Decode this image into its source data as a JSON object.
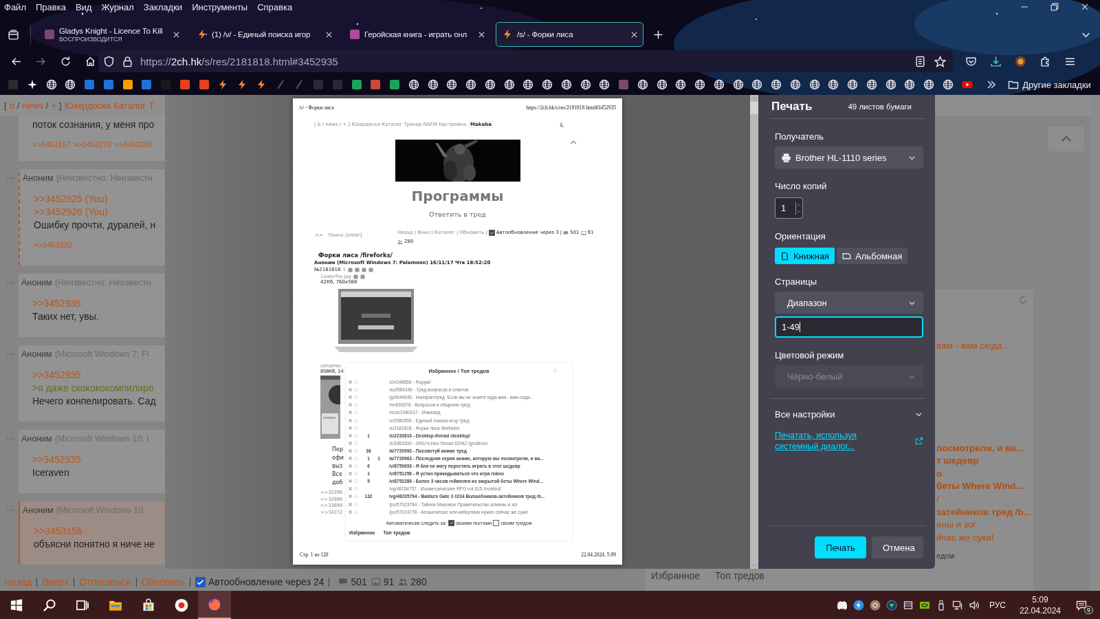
{
  "menu": [
    "Файл",
    "Правка",
    "Вид",
    "Журнал",
    "Закладки",
    "Инструменты",
    "Справка"
  ],
  "tabs": [
    {
      "kind": "letter",
      "title": "Gladys Knight - Licence To Kill",
      "subtitle": "ВОСПРОИЗВОДИТСЯ",
      "selected": false
    },
    {
      "kind": "bolt",
      "title": "(1) /v/ - Единый поиска игор",
      "selected": false
    },
    {
      "kind": "game",
      "title": "Геройская книга - играть онл",
      "selected": false
    },
    {
      "kind": "bolt",
      "title": "/s/ - Форки лиса",
      "selected": true
    }
  ],
  "address": {
    "scheme": "https://",
    "host": "2ch.hk",
    "path": "/s/res/2181818.html#3452935"
  },
  "other_bookmarks": "Другие закладки",
  "page": {
    "nav": [
      {
        "kind": "plain",
        "text": "["
      },
      {
        "kind": "link",
        "text": "b"
      },
      {
        "kind": "plain",
        "text": "/"
      },
      {
        "kind": "link",
        "text": "news"
      },
      {
        "kind": "plain",
        "text": "/"
      },
      {
        "kind": "link",
        "text": "+"
      },
      {
        "kind": "plain",
        "text": "]"
      },
      {
        "kind": "link",
        "text": "Юзердоски"
      },
      {
        "kind": "link",
        "text": "Каталог"
      },
      {
        "kind": "link",
        "text": "Т"
      }
    ],
    "posts": [
      {
        "kind": "normal",
        "lines": [
          {
            "kind": "text",
            "text": "поток сознания, у меня про"
          },
          {
            "kind": "backrefs",
            "refs": [
              ">>3453157",
              ">>3453270",
              ">>3453289"
            ]
          }
        ]
      },
      {
        "kind": "reply",
        "author": "Аноним",
        "meta": "(Неизвестно: Неизвестн",
        "lines": [
          {
            "kind": "ref",
            "text": ">>3452925 (You)"
          },
          {
            "kind": "ref",
            "text": ">>3452926 (You)"
          },
          {
            "kind": "text",
            "text": "Ошибку прочти, дуралей, н"
          },
          {
            "kind": "backrefs",
            "refs": [
              ">>3453330"
            ]
          }
        ]
      },
      {
        "kind": "normal",
        "author": "Аноним",
        "meta": "(Неизвестно: Неизвестн",
        "lines": [
          {
            "kind": "ref",
            "text": ">>3452935"
          },
          {
            "kind": "text",
            "text": "Таких нет, увы."
          }
        ]
      },
      {
        "kind": "normal",
        "author": "Аноним",
        "meta": "(Microsoft Windows 7: Fi",
        "lines": [
          {
            "kind": "ref",
            "text": ">>3452935"
          },
          {
            "kind": "quote",
            "text": ">я даже скокококомпилиро"
          },
          {
            "kind": "text",
            "text": "Нечего конпелировать. Сад"
          }
        ]
      },
      {
        "kind": "normal",
        "author": "Аноним",
        "meta": "(Microsoft Windows 10: I",
        "lines": [
          {
            "kind": "ref",
            "text": ">>3452935"
          },
          {
            "kind": "text",
            "text": "Iceraven"
          }
        ]
      },
      {
        "kind": "highlighted",
        "author": "Аноним",
        "meta": "(Microsoft Windows 10:",
        "lines": [
          {
            "kind": "ref",
            "text": ">>3453156"
          },
          {
            "kind": "text",
            "text": "объясни понятно я ниче не"
          }
        ]
      }
    ],
    "bottom_links": [
      "Назад",
      "Вверх",
      "Отписаться",
      "Обновить"
    ],
    "autoupdate": {
      "label": "Автообновление через 24",
      "checked": true
    },
    "stats": {
      "posts": "501",
      "images": "91",
      "posters": "280"
    },
    "favorites_fragments": [
      {
        "text": "вам - вам сюда...",
        "unread": false
      },
      {
        "text": "посмотрели, и ва...",
        "unread": true
      },
      {
        "text": "т шедевр",
        "unread": true
      },
      {
        "text": "о",
        "unread": true
      },
      {
        "text": "беты Where Wind...",
        "unread": true
      },
      {
        "text": "/",
        "unread": false
      },
      {
        "text": "затейников тред /b...",
        "unread": true
      },
      {
        "text": "ены и зог",
        "unread": false
      },
      {
        "text": "йчас же суки!",
        "unread": false
      }
    ],
    "favorites_watch_fragment": "едом",
    "favorites_tabs": [
      "Избранное",
      "Топ тредов"
    ]
  },
  "preview": {
    "header_title": "/s/ - Форки лиса",
    "header_url": "https://2ch.hk/s/res/2181818.html#3452935",
    "nav": "[ b / news / + ] Юзердоски Каталог Трекер NSFW Настройки",
    "style": "Makaba",
    "board_title": "Программы",
    "reply": "Ответить в тред",
    "search_prefix": ">>",
    "search": "Поиск [enter]",
    "thread_nav": "Назад | Вниз | Каталог | Обновить |",
    "autoupdate": {
      "label": "Автообновление через 3 |",
      "checked": true
    },
    "stats": {
      "posts": "501",
      "images": "91",
      "posters": "280"
    },
    "thread": {
      "title": "Форки лиса /fireforks/",
      "author": "Аноним (Microsoft Windows 7: Palemoon)  16/11/17 Чтв 18:52:20",
      "number": "№2181818",
      "replies": "1",
      "file": "1waterfox.jpg",
      "file_info": "42Кб, 760x588"
    },
    "hidden_post": {
      "file": "unnamec",
      "file_info": "858Кб, 14",
      "lines": [
        "Пер",
        "офи",
        "выз",
        "Все",
        "доб"
      ],
      "refs": [
        ">>32296",
        ">>32698",
        ">>33699",
        ">>34272"
      ]
    },
    "favorites": {
      "title": "Избранное / Топ тредов",
      "rows": [
        {
          "count": "",
          "replies": "",
          "title": "/ch/248856 - Форум!"
        },
        {
          "count": "",
          "replies": "",
          "title": "/sci/584346 - Тред вопросов и ответов"
        },
        {
          "count": "",
          "replies": "",
          "title": "/gd/644645 - Ньюфаготред. Если вы не знаете куда вам - вам сюда..."
        },
        {
          "count": "",
          "replies": "",
          "title": "/re/693576 - Вопросов и общения тред"
        },
        {
          "count": "",
          "replies": "",
          "title": "/mus/1060017 - Инвалид"
        },
        {
          "count": "",
          "replies": "",
          "title": "/v/2080955 - Единый поиска игор тред"
        },
        {
          "count": "",
          "replies": "",
          "title": "/s/2181818 - Форки лиса /fireforks/"
        },
        {
          "count": "1",
          "replies": "",
          "title": "/s/2233610 - Desktop-thread /desktop/"
        },
        {
          "count": "",
          "replies": "",
          "title": "/s/3453300 - GNU+Linux thread #2042 /gnulinux/"
        },
        {
          "count": "36",
          "replies": "",
          "title": "/a/7720993 - Посоветуй аниме тред"
        },
        {
          "count": "1",
          "replies": "1",
          "title": "/a/7729963 - Последняя серия аниме, которую вы посмотрели, и ва..."
        },
        {
          "count": "6",
          "replies": "",
          "title": "/v/8750693 - Я бля не могу перестать играть в этот шедевр"
        },
        {
          "count": "1",
          "replies": "",
          "title": "/v/8751258 - Я устал прикидываться что игра говно"
        },
        {
          "count": "5",
          "replies": "",
          "title": "/v/8752289 - Более 3 часов геймплея из закрытой беты Where Wind..."
        },
        {
          "count": "",
          "replies": "",
          "title": "/vg/48154757 - Изометрические RPG vol.615 /nondnd/"
        },
        {
          "count": "132",
          "replies": "",
          "title": "/vg/48235794 - Baldurs Gate 3 #234 Волшебников-затейников тред /b..."
        },
        {
          "count": "",
          "replies": "",
          "title": "/po/57023784 - Тайное Мировое Правительство алиены и зог"
        },
        {
          "count": "",
          "replies": "",
          "title": "/po/57024778 - Апокалипсис или киберпанк нужен сейчас же суки!"
        }
      ],
      "watch_label": "Автоматически следить за:",
      "watch_options": [
        {
          "label": "своими постами",
          "checked": true
        },
        {
          "label": "своим тредом",
          "checked": false
        }
      ],
      "tabs": [
        "Избранное",
        "Топ тредов"
      ]
    },
    "footer_left": "Стр. 1 из 120",
    "footer_right": "22.04.2024, 5:09"
  },
  "dialog": {
    "title": "Печать",
    "sheets": "49 листов бумаги",
    "destination_label": "Получатель",
    "printer": "Brother HL-1110 series",
    "copies_label": "Число копий",
    "copies": "1",
    "orientation_label": "Ориентация",
    "orientations": [
      {
        "kind": "portrait",
        "label": "Книжная",
        "selected": true
      },
      {
        "kind": "landscape",
        "label": "Альбомная",
        "selected": false
      }
    ],
    "pages_label": "Страницы",
    "pages_mode": "Диапазон",
    "pages_range": "1-49",
    "color_label": "Цветовой режим",
    "color_mode": {
      "value": "Чёрно-белый",
      "disabled": true
    },
    "more_settings": {
      "label": "Все настройки",
      "expanded": false
    },
    "system_dialog": "Печатать, используя системный диалог...",
    "buttons": [
      {
        "kind": "primary",
        "label": "Печать"
      },
      {
        "kind": "secondary",
        "label": "Отмена"
      }
    ]
  },
  "taskbar": {
    "apps": [
      {
        "kind": "start",
        "active": false
      },
      {
        "kind": "search",
        "active": false
      },
      {
        "kind": "taskview",
        "active": false
      },
      {
        "kind": "explorer",
        "active": false
      },
      {
        "kind": "store",
        "active": false
      },
      {
        "kind": "yandex",
        "active": false
      },
      {
        "kind": "firefox",
        "active": true
      }
    ],
    "lang": "РУС",
    "time": "5:09",
    "date": "22.04.2024",
    "notifications": "9"
  }
}
